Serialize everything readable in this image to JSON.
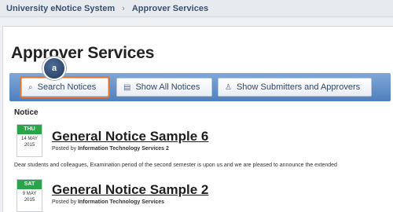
{
  "breadcrumb": {
    "root": "University eNotice System",
    "current": "Approver Services"
  },
  "page_title": "Approver Services",
  "marker_label": "a",
  "toolbar": {
    "search_label": "Search Notices",
    "show_all_label": "Show All Notices",
    "submitters_label": "Show Submitters and Approvers"
  },
  "list_header": "Notice",
  "notices": [
    {
      "dow": "THU",
      "day_month": "14 MAY",
      "year": "2015",
      "title": "General Notice Sample 6",
      "posted_prefix": "Posted by",
      "posted_by": "Information Technology Services 2",
      "body": "Dear students and colleagues, Examination period of the second semester is upon us and we are pleased to announce the extended"
    },
    {
      "dow": "SAT",
      "day_month": "9 MAY",
      "year": "2015",
      "title": "General Notice Sample 2",
      "posted_prefix": "Posted by",
      "posted_by": "Information Technology Services"
    }
  ],
  "colors": {
    "toolbar": "#5f8cc6",
    "active_outline": "#e8752f",
    "date_header": "#2ba34a"
  },
  "icons": {
    "search": "search-icon",
    "list": "list-icon",
    "user": "user-icon"
  }
}
